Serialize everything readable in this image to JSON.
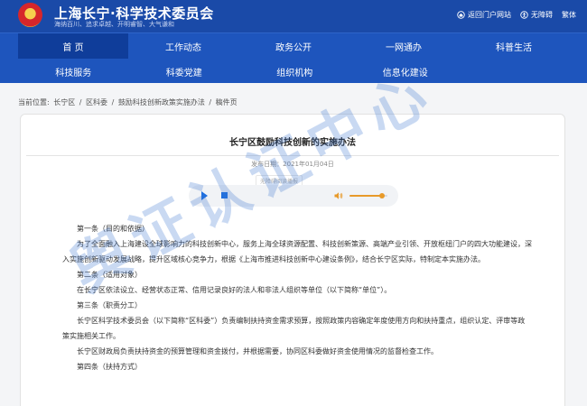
{
  "header": {
    "site_title": "上海长宁·科学技术委员会",
    "slogan": "海纳百川、追求卓越、开明睿智、大气谦和",
    "links": [
      {
        "label": "返回门户网站",
        "icon": "home-icon"
      },
      {
        "label": "无障碍",
        "icon": "accessibility-icon"
      },
      {
        "label": "繁体",
        "icon": ""
      }
    ]
  },
  "nav": {
    "row1": [
      "首 页",
      "工作动态",
      "政务公开",
      "一网通办",
      "科普生活"
    ],
    "row2": [
      "科技服务",
      "科委党建",
      "组织机构",
      "信息化建设"
    ],
    "active": "首 页"
  },
  "breadcrumb": {
    "prefix": "当前位置:",
    "items": [
      "长宁区",
      "区科委",
      "鼓励科技创新政策实施办法",
      "稿件页"
    ],
    "separator": "/"
  },
  "article": {
    "title": "长宁区鼓励科技创新的实施办法",
    "date": "发布日期：2021年01月04日",
    "player_label": "无障碍阅读播报",
    "volume_level": 0.85,
    "paragraphs": [
      "第一条（目的和依据）",
      "为了全面融入上海建设全球影响力的科技创新中心，服务上海全球资源配置、科技创新策源、高端产业引领、开放枢纽门户的四大功能建设，深入实施创新驱动发展战略，提升区域核心竞争力，根据《上海市推进科技创新中心建设条例》，结合长宁区实际，特制定本实施办法。",
      "第二条（适用对象）",
      "在长宁区依法设立、经营状态正常、信用记录良好的法人和非法人组织等单位（以下简称“单位”）。",
      "第三条（职责分工）",
      "长宁区科学技术委员会（以下简称“区科委”）负责编制扶持资金需求预算，按照政策内容确定年度使用方向和扶持重点，组织认定、评审等政策实施相关工作。",
      "长宁区财政局负责扶持资金的预算管理和资金拨付，并根据需要，协同区科委做好资金使用情况的监督检查工作。",
      "第四条（扶持方式）"
    ]
  },
  "watermark": "舆证认证中心",
  "colors": {
    "header_bg": "#1a4aa8",
    "nav_bg": "#1e55bd",
    "nav_active": "#0f3d9a",
    "accent": "#1e6fe0",
    "volume": "#e89a2a"
  }
}
